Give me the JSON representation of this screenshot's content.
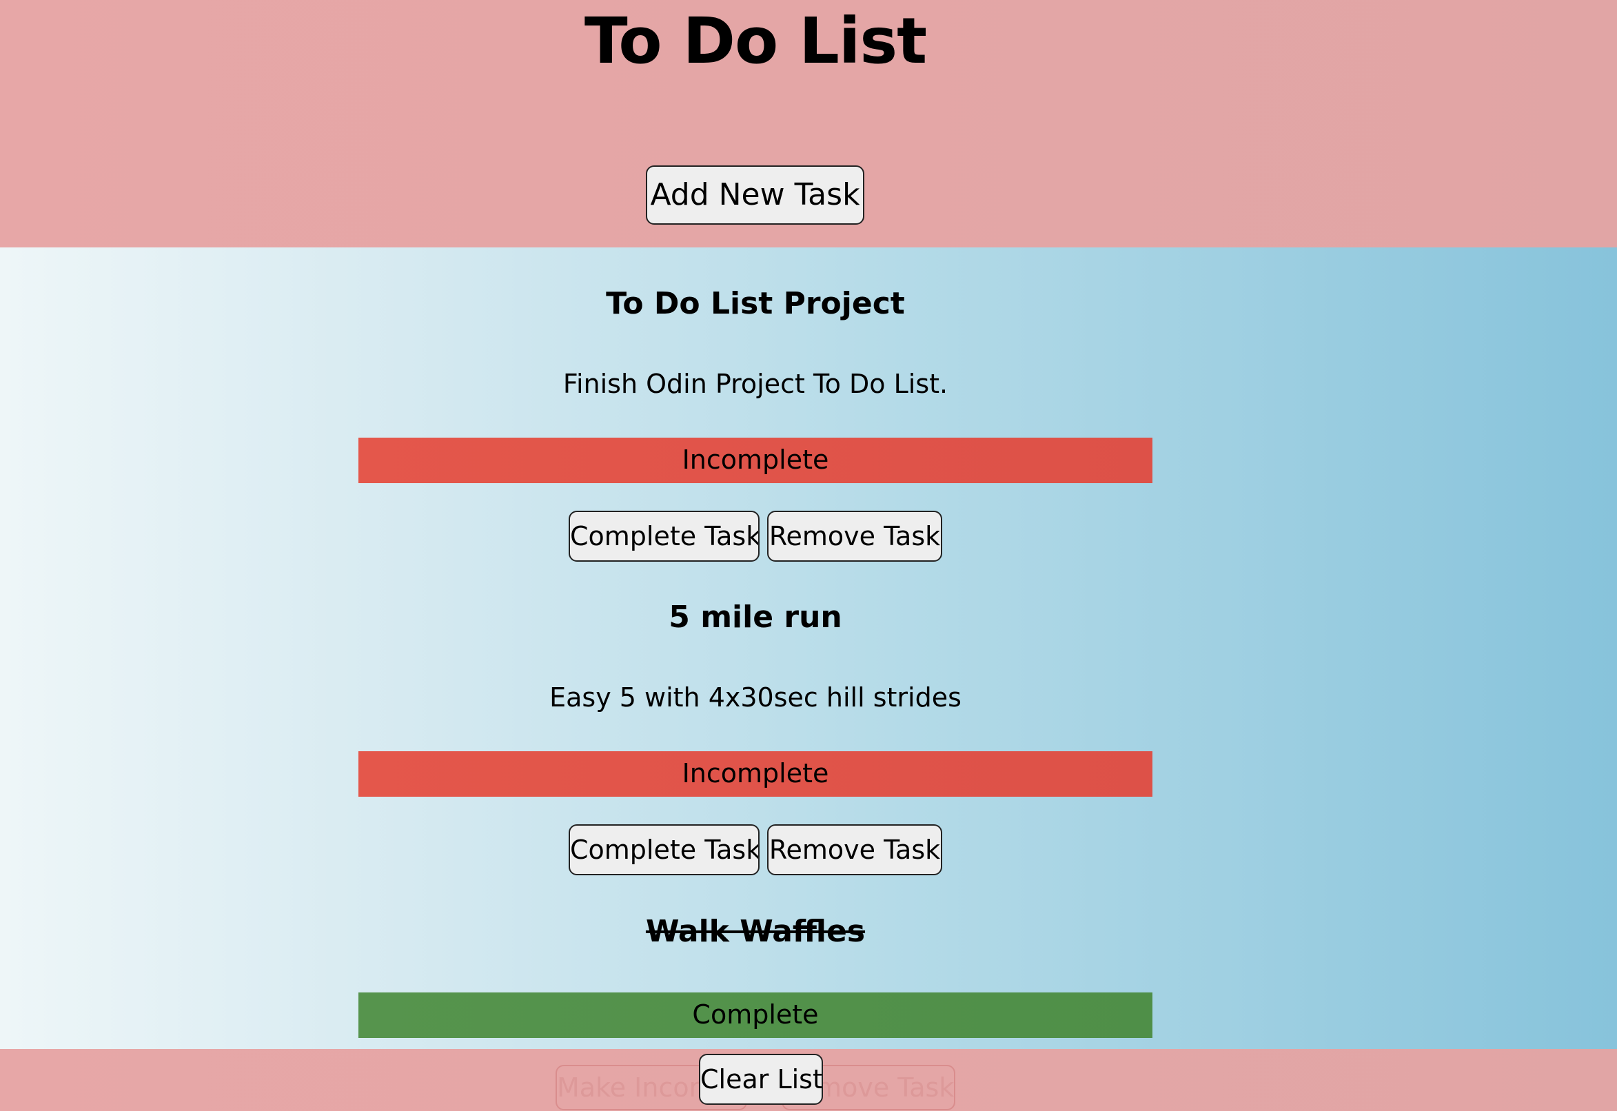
{
  "header": {
    "title": "To Do List",
    "add_button_label": "Add New Task"
  },
  "tasks": [
    {
      "title": "To Do List Project",
      "description": "Finish Odin Project To Do List.",
      "status": "Incomplete",
      "complete_button_label": "Complete Task",
      "remove_button_label": "Remove Task",
      "status_color": "#e4574b"
    },
    {
      "title": "5 mile run",
      "description": "Easy 5 with 4x30sec hill strides",
      "status": "Incomplete",
      "complete_button_label": "Complete Task",
      "remove_button_label": "Remove Task",
      "status_color": "#e4574b"
    },
    {
      "title": "Walk Waffles",
      "description": "",
      "status": "Complete",
      "make_incomplete_button_label": "Make Incomplete",
      "remove_button_label": "Remove Task",
      "status_color": "#56944d"
    }
  ],
  "footer": {
    "clear_button_label": "Clear List"
  },
  "colors": {
    "header_background": "#e7a7a7",
    "incomplete": "#e4574b",
    "complete": "#56944d",
    "main_gradient_start": "#eef6f8",
    "main_gradient_end": "#87c3db"
  }
}
